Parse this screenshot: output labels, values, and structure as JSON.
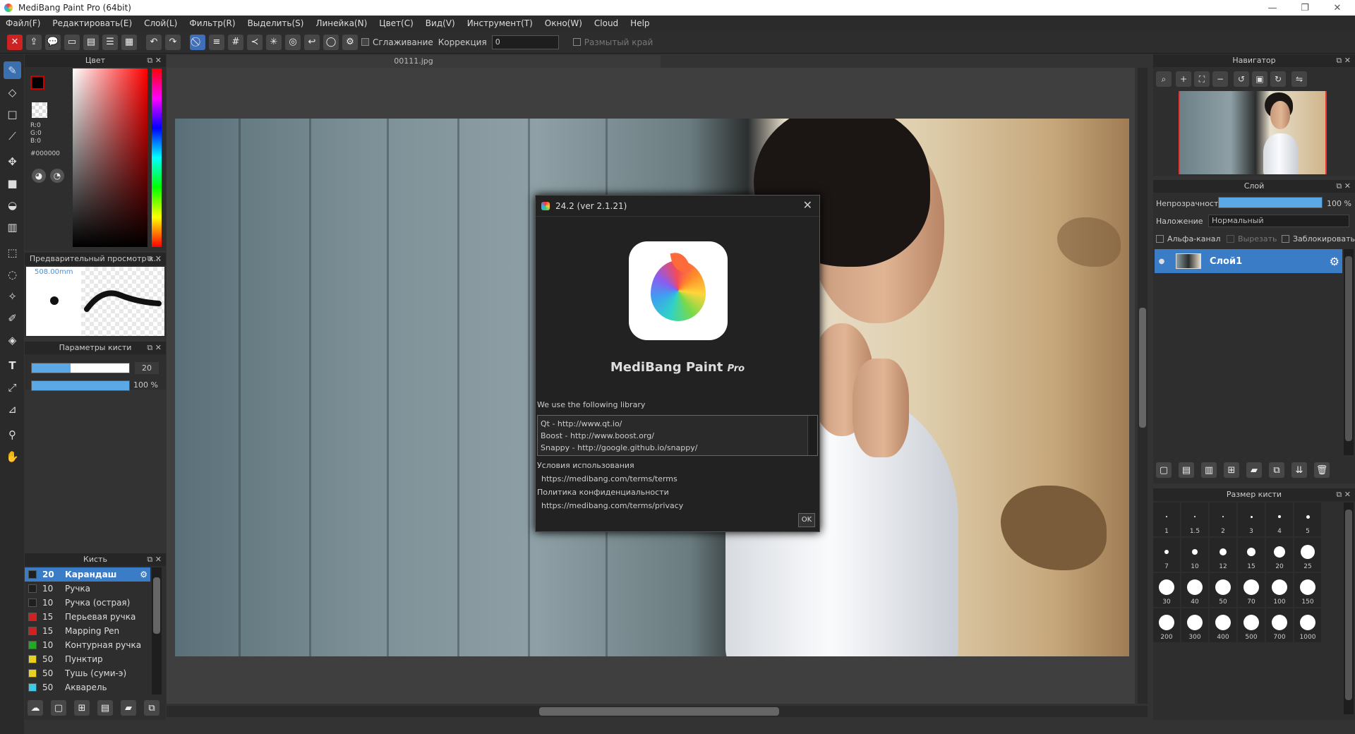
{
  "window": {
    "title": "MediBang Paint Pro (64bit)",
    "controls": [
      "—",
      "❐",
      "✕"
    ]
  },
  "menu": [
    "Файл(F)",
    "Редактировать(E)",
    "Слой(L)",
    "Фильтр(R)",
    "Выделить(S)",
    "Линейка(N)",
    "Цвет(C)",
    "Вид(V)",
    "Инструмент(T)",
    "Окно(W)",
    "Cloud",
    "Help"
  ],
  "toolbar": {
    "smoothing_label": "Сглаживание",
    "correction_label": "Коррекция",
    "correction_value": "0",
    "soft_edge_label": "Размытый край"
  },
  "color_panel": {
    "title": "Цвет",
    "r": "R:0",
    "g": "G:0",
    "b": "B:0",
    "hex": "#000000",
    "primary": "#cc0000"
  },
  "brush_preview": {
    "title": "Предварительный просмотр к...",
    "size": "508.00mm"
  },
  "brush_params": {
    "title": "Параметры кисти",
    "size_value": "20",
    "opacity_value": "100 %"
  },
  "brush_list": {
    "title": "Кисть",
    "items": [
      {
        "size": "20",
        "name": "Карандаш",
        "color": "#1f1f1f",
        "active": true
      },
      {
        "size": "10",
        "name": "Ручка",
        "color": "#1f1f1f"
      },
      {
        "size": "10",
        "name": "Ручка (острая)",
        "color": "#1f1f1f"
      },
      {
        "size": "15",
        "name": "Перьевая ручка",
        "color": "#d02020"
      },
      {
        "size": "15",
        "name": "Mapping Pen",
        "color": "#d02020"
      },
      {
        "size": "10",
        "name": "Контурная ручка",
        "color": "#22aa22"
      },
      {
        "size": "50",
        "name": "Пунктир",
        "color": "#e8d020"
      },
      {
        "size": "50",
        "name": "Тушь (суми-э)",
        "color": "#e8d020"
      },
      {
        "size": "50",
        "name": "Акварель",
        "color": "#40c8e8"
      }
    ]
  },
  "document": {
    "tab": "00111.jpg"
  },
  "dialog": {
    "title": "24.2 (ver 2.1.21)",
    "app_name": "MediBang Paint",
    "app_suffix": "Pro",
    "lib_heading": "We use the following library",
    "libs": [
      "Qt - http://www.qt.io/",
      "Boost - http://www.boost.org/",
      "Snappy - http://google.github.io/snappy/"
    ],
    "terms_label": "Условия использования",
    "terms_url": "https://medibang.com/terms/terms",
    "privacy_label": "Политика конфиденциальности",
    "privacy_url": "https://medibang.com/terms/privacy",
    "ok": "OK"
  },
  "navigator": {
    "title": "Навигатор"
  },
  "layer_panel": {
    "title": "Слой",
    "opacity_label": "Непрозрачность",
    "opacity_value": "100 %",
    "blend_label": "Наложение",
    "blend_value": "Нормальный",
    "alpha_label": "Альфа-канал",
    "clip_label": "Вырезать",
    "lock_label": "Заблокировать",
    "layer_name": "Слой1"
  },
  "brush_size": {
    "title": "Размер кисти",
    "sizes": [
      "1",
      "1.5",
      "2",
      "3",
      "4",
      "5",
      "7",
      "10",
      "12",
      "15",
      "20",
      "25",
      "30",
      "40",
      "50",
      "70",
      "100",
      "150",
      "200",
      "300",
      "400",
      "500",
      "700",
      "1000"
    ]
  }
}
